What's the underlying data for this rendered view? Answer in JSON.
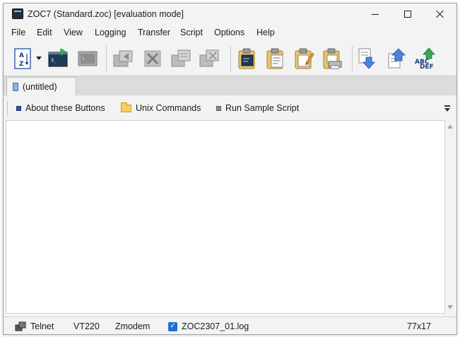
{
  "window": {
    "title": "ZOC7 (Standard.zoc) [evaluation mode]"
  },
  "menu": {
    "items": [
      "File",
      "Edit",
      "View",
      "Logging",
      "Transfer",
      "Script",
      "Options",
      "Help"
    ]
  },
  "toolbar": {
    "buttons": [
      "sort-az-icon",
      "dropdown-arrow-icon",
      "terminal-connect-icon",
      "terminal-disconnected-icon",
      "window-back-icon",
      "close-connection-icon",
      "copy-window-icon",
      "window-remove-icon",
      "clipboard-terminal-icon",
      "clipboard-document-icon",
      "clipboard-edit-icon",
      "clipboard-print-icon",
      "download-file-icon",
      "upload-file-icon",
      "abc-def-icon"
    ]
  },
  "tabs": [
    {
      "label": "(untitled)"
    }
  ],
  "buttonbar": {
    "items": [
      {
        "label": "About these Buttons",
        "icon": "blue-square-icon"
      },
      {
        "label": "Unix Commands",
        "icon": "folder-icon"
      },
      {
        "label": "Run Sample Script",
        "icon": "gray-square-icon"
      }
    ]
  },
  "status": {
    "connection": "Telnet",
    "emulation": "VT220",
    "transfer": "Zmodem",
    "logfile": "ZOC2307_01.log",
    "size": "77x17"
  },
  "colors": {
    "accent": "#1f6fd0",
    "window_bg": "#f3f3f3"
  }
}
